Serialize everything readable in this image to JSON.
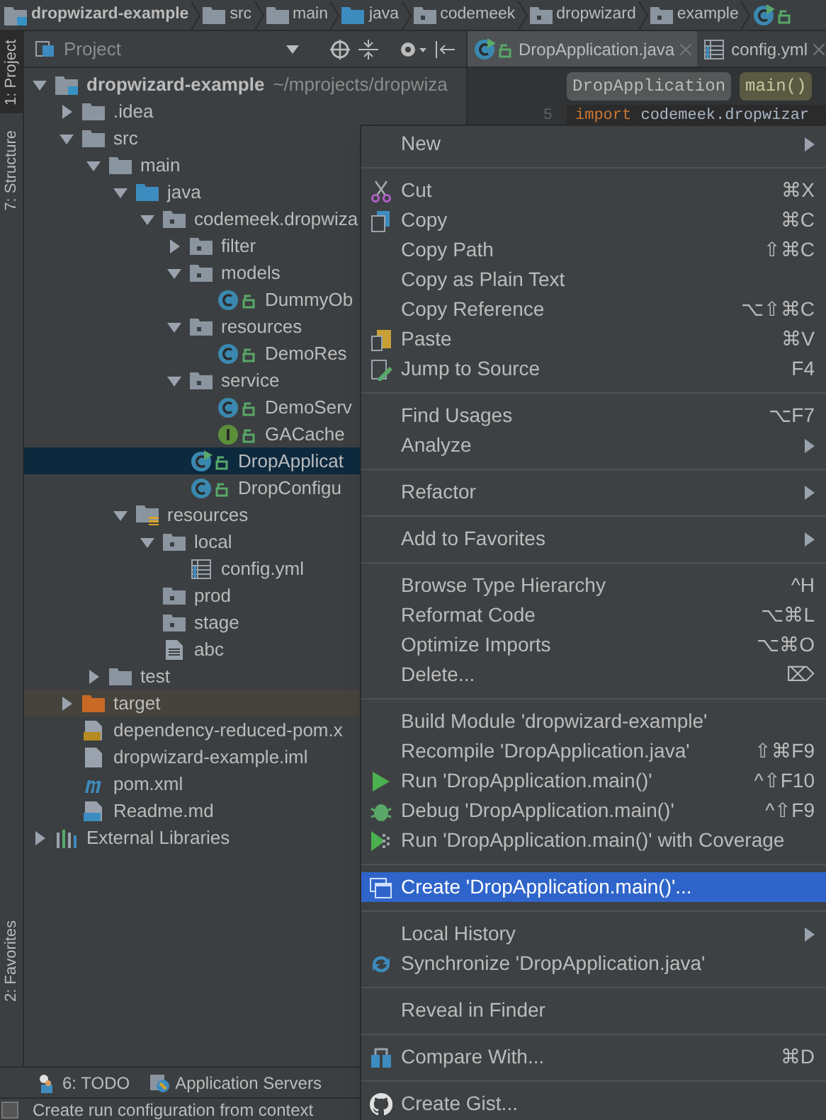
{
  "breadcrumbs": [
    {
      "label": "dropwizard-example",
      "kind": "module"
    },
    {
      "label": "src",
      "kind": "folder"
    },
    {
      "label": "main",
      "kind": "folder"
    },
    {
      "label": "java",
      "kind": "source-folder"
    },
    {
      "label": "codemeek",
      "kind": "package"
    },
    {
      "label": "dropwizard",
      "kind": "package"
    },
    {
      "label": "example",
      "kind": "package"
    },
    {
      "kind": "run-class"
    }
  ],
  "side_tabs": [
    {
      "label": "1: Project",
      "selected": true
    },
    {
      "label": "7: Structure",
      "selected": false
    }
  ],
  "side_tabs_bottom": [
    {
      "label": "2: Favorites",
      "selected": false
    }
  ],
  "project_panel": {
    "title": "Project"
  },
  "tree": [
    {
      "name": "dropwizard-example",
      "kind": "module",
      "hint": "~/mprojects/dropwiza",
      "expanded": true,
      "selected": false,
      "children": [
        {
          "name": ".idea",
          "kind": "folder",
          "expanded": false,
          "selected": false
        },
        {
          "name": "src",
          "kind": "folder",
          "expanded": true,
          "selected": false,
          "children": [
            {
              "name": "main",
              "kind": "folder",
              "expanded": true,
              "selected": false,
              "children": [
                {
                  "name": "java",
                  "kind": "source-folder",
                  "expanded": true,
                  "selected": false,
                  "children": [
                    {
                      "name": "codemeek.dropwiza",
                      "kind": "package",
                      "expanded": true,
                      "selected": false,
                      "children": [
                        {
                          "name": "filter",
                          "kind": "package",
                          "expanded": false,
                          "selected": false
                        },
                        {
                          "name": "models",
                          "kind": "package",
                          "expanded": true,
                          "selected": false,
                          "children": [
                            {
                              "name": "DummyOb",
                              "kind": "class",
                              "selected": false
                            }
                          ]
                        },
                        {
                          "name": "resources",
                          "kind": "package",
                          "expanded": true,
                          "selected": false,
                          "children": [
                            {
                              "name": "DemoRes",
                              "kind": "class",
                              "selected": false
                            }
                          ]
                        },
                        {
                          "name": "service",
                          "kind": "package",
                          "expanded": true,
                          "selected": false,
                          "children": [
                            {
                              "name": "DemoServ",
                              "kind": "class",
                              "selected": false
                            },
                            {
                              "name": "GACache",
                              "kind": "interface",
                              "selected": false
                            }
                          ]
                        },
                        {
                          "name": "DropApplicat",
                          "kind": "run-class",
                          "selected": true
                        },
                        {
                          "name": "DropConfigu",
                          "kind": "class",
                          "selected": false
                        }
                      ]
                    }
                  ]
                },
                {
                  "name": "resources",
                  "kind": "resources-folder",
                  "expanded": true,
                  "selected": false,
                  "children": [
                    {
                      "name": "local",
                      "kind": "package",
                      "expanded": true,
                      "selected": false,
                      "children": [
                        {
                          "name": "config.yml",
                          "kind": "yml",
                          "selected": false
                        }
                      ]
                    },
                    {
                      "name": "prod",
                      "kind": "package",
                      "selected": false
                    },
                    {
                      "name": "stage",
                      "kind": "package",
                      "selected": false
                    },
                    {
                      "name": "abc",
                      "kind": "text",
                      "selected": false
                    }
                  ]
                }
              ]
            },
            {
              "name": "test",
              "kind": "folder",
              "expanded": false,
              "selected": false
            }
          ]
        },
        {
          "name": "target",
          "kind": "excluded-folder",
          "expanded": false,
          "selected": false
        },
        {
          "name": "dependency-reduced-pom.x",
          "kind": "xml",
          "selected": false
        },
        {
          "name": "dropwizard-example.iml",
          "kind": "iml",
          "selected": false
        },
        {
          "name": "pom.xml",
          "kind": "maven",
          "selected": false
        },
        {
          "name": "Readme.md",
          "kind": "markdown",
          "selected": false
        }
      ]
    },
    {
      "name": "External Libraries",
      "kind": "libraries",
      "expanded": false,
      "selected": false
    }
  ],
  "editor_tabs": [
    {
      "label": "DropApplication.java",
      "kind": "run-class",
      "selected": true
    },
    {
      "label": "config.yml",
      "kind": "yml",
      "selected": false
    }
  ],
  "editor_breadcrumbs": [
    {
      "label": "DropApplication",
      "kind": "class"
    },
    {
      "label": "main()",
      "kind": "method"
    }
  ],
  "code_lines": [
    {
      "number": "5",
      "keyword": "import",
      "text": "codemeek.dropwizar"
    }
  ],
  "context_menu": [
    [
      {
        "kind": "plain",
        "label": "New",
        "submenu": true,
        "selected": false
      }
    ],
    [
      {
        "kind": "cut",
        "label": "Cut",
        "shortcut": "⌘X",
        "selected": false
      },
      {
        "kind": "copy",
        "label": "Copy",
        "shortcut": "⌘C",
        "selected": false
      },
      {
        "kind": "plain",
        "label": "Copy Path",
        "shortcut": "⇧⌘C",
        "selected": false
      },
      {
        "kind": "plain",
        "label": "Copy as Plain Text",
        "selected": false
      },
      {
        "kind": "plain",
        "label": "Copy Reference",
        "shortcut": "⌥⇧⌘C",
        "selected": false
      },
      {
        "kind": "paste",
        "label": "Paste",
        "shortcut": "⌘V",
        "selected": false
      },
      {
        "kind": "jump",
        "label": "Jump to Source",
        "shortcut": "F4",
        "selected": false
      }
    ],
    [
      {
        "kind": "plain",
        "label": "Find Usages",
        "shortcut": "⌥F7",
        "selected": false
      },
      {
        "kind": "plain",
        "label": "Analyze",
        "submenu": true,
        "selected": false
      }
    ],
    [
      {
        "kind": "plain",
        "label": "Refactor",
        "submenu": true,
        "selected": false
      }
    ],
    [
      {
        "kind": "plain",
        "label": "Add to Favorites",
        "submenu": true,
        "selected": false
      }
    ],
    [
      {
        "kind": "plain",
        "label": "Browse Type Hierarchy",
        "shortcut": "^H",
        "selected": false
      },
      {
        "kind": "plain",
        "label": "Reformat Code",
        "shortcut": "⌥⌘L",
        "selected": false
      },
      {
        "kind": "plain",
        "label": "Optimize Imports",
        "shortcut": "⌥⌘O",
        "selected": false
      },
      {
        "kind": "plain",
        "label": "Delete...",
        "shortcut": "⌦",
        "selected": false
      }
    ],
    [
      {
        "kind": "plain",
        "label": "Build Module 'dropwizard-example'",
        "selected": false
      },
      {
        "kind": "plain",
        "label": "Recompile 'DropApplication.java'",
        "shortcut": "⇧⌘F9",
        "selected": false
      },
      {
        "kind": "run",
        "label": "Run 'DropApplication.main()'",
        "shortcut": "^⇧F10",
        "selected": false
      },
      {
        "kind": "debug",
        "label": "Debug 'DropApplication.main()'",
        "shortcut": "^⇧F9",
        "selected": false
      },
      {
        "kind": "coverage",
        "label": "Run 'DropApplication.main()' with Coverage",
        "selected": false
      }
    ],
    [
      {
        "kind": "create",
        "label": "Create 'DropApplication.main()'...",
        "selected": true
      }
    ],
    [
      {
        "kind": "plain",
        "label": "Local History",
        "submenu": true,
        "selected": false
      },
      {
        "kind": "sync",
        "label": "Synchronize 'DropApplication.java'",
        "selected": false
      }
    ],
    [
      {
        "kind": "plain",
        "label": "Reveal in Finder",
        "selected": false
      }
    ],
    [
      {
        "kind": "compare",
        "label": "Compare With...",
        "shortcut": "⌘D",
        "selected": false
      }
    ],
    [
      {
        "kind": "github",
        "label": "Create Gist...",
        "selected": false
      }
    ]
  ],
  "tool_windows": [
    {
      "label": "6: TODO",
      "kind": "todo"
    },
    {
      "label": "Application Servers",
      "kind": "servers"
    }
  ],
  "status_bar": {
    "message": "Create run configuration from context"
  }
}
